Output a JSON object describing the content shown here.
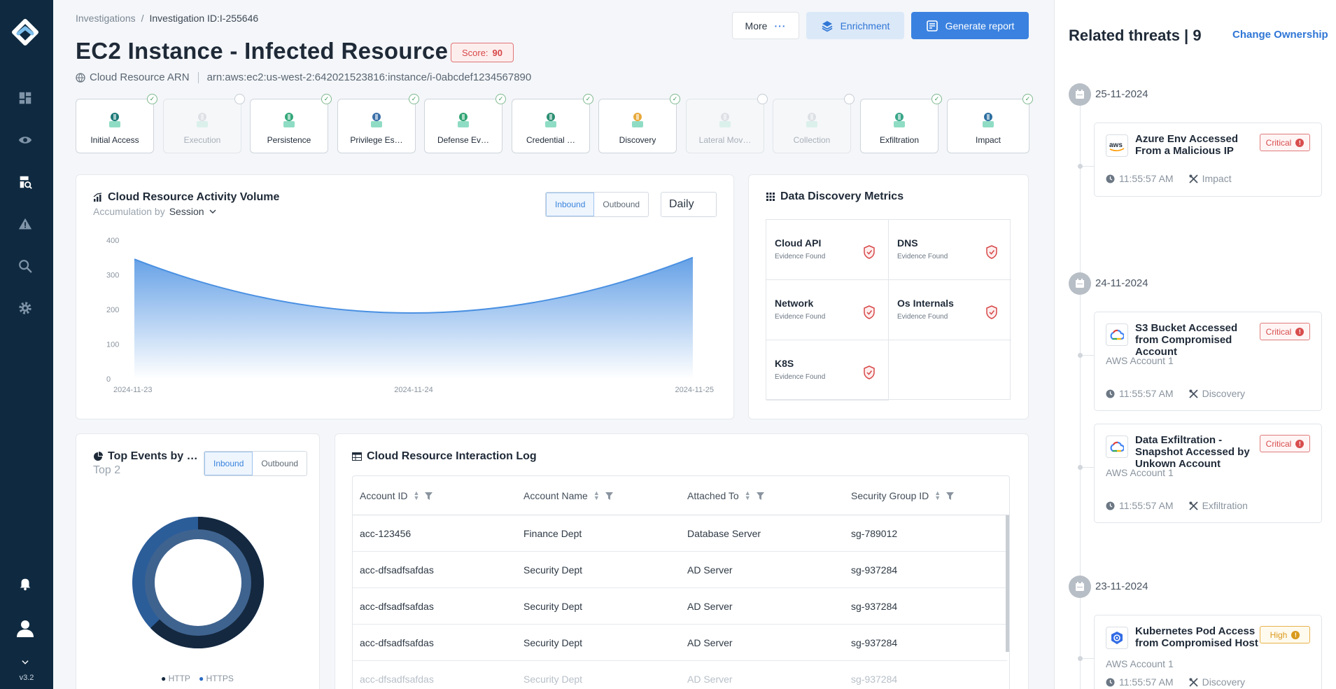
{
  "app": {
    "version": "v3.2"
  },
  "sidebar": {
    "items": [
      {
        "icon": "dashboard-icon"
      },
      {
        "icon": "eye-icon"
      },
      {
        "icon": "investigation-icon",
        "active": true
      },
      {
        "icon": "alert-icon"
      },
      {
        "icon": "search-icon"
      },
      {
        "icon": "gear-icon"
      }
    ],
    "bottom": [
      {
        "icon": "bell-icon"
      },
      {
        "icon": "user-icon"
      },
      {
        "icon": "chevron-down-icon"
      }
    ]
  },
  "breadcrumb": {
    "root": "Investigations",
    "sep": "/",
    "current": "Investigation ID:I-255646"
  },
  "header": {
    "title": "EC2 Instance - Infected Resource",
    "score_label": "Score:",
    "score_value": "90",
    "resource_type": "Cloud Resource ARN",
    "arn": "arn:aws:ec2:us-west-2:642021523816:instance/i-0abcdef1234567890"
  },
  "actions": {
    "more": "More",
    "enrichment": "Enrichment",
    "generate_report": "Generate report"
  },
  "tactics": [
    {
      "label": "Initial Access",
      "enabled": true
    },
    {
      "label": "Execution",
      "enabled": false
    },
    {
      "label": "Persistence",
      "enabled": true
    },
    {
      "label": "Privilege Es…",
      "enabled": true
    },
    {
      "label": "Defense Ev…",
      "enabled": true
    },
    {
      "label": "Credential …",
      "enabled": true
    },
    {
      "label": "Discovery",
      "enabled": true
    },
    {
      "label": "Lateral Mov…",
      "enabled": false
    },
    {
      "label": "Collection",
      "enabled": false
    },
    {
      "label": "Exfiltration",
      "enabled": true
    },
    {
      "label": "Impact",
      "enabled": true
    }
  ],
  "activity": {
    "title": "Cloud Resource Activity Volume",
    "accum_label": "Accumulation by",
    "accum_value": "Session",
    "toggle": [
      "Inbound",
      "Outbound"
    ],
    "period": "Daily"
  },
  "chart_data": {
    "type": "area",
    "x": [
      "2024-11-23",
      "2024-11-24",
      "2024-11-25"
    ],
    "y_ticks": [
      "400",
      "300",
      "200",
      "100",
      "0"
    ],
    "ylim": [
      0,
      400
    ],
    "series": [
      {
        "values": [
          345,
          190,
          350
        ]
      }
    ],
    "color": "#4a90e2"
  },
  "metrics": {
    "title": "Data Discovery Metrics",
    "items": [
      {
        "name": "Cloud API",
        "status": "Evidence Found"
      },
      {
        "name": "DNS",
        "status": "Evidence Found"
      },
      {
        "name": "Network",
        "status": "Evidence Found"
      },
      {
        "name": "Os Internals",
        "status": "Evidence Found"
      },
      {
        "name": "K8S",
        "status": "Evidence Found"
      }
    ]
  },
  "top_events": {
    "title": "Top Events by …",
    "subtitle": "Top 2",
    "toggle": [
      "Inbound",
      "Outbound"
    ],
    "legend": [
      "HTTP",
      "HTTPS"
    ],
    "colors": [
      "#12263f",
      "#2a5a94"
    ]
  },
  "log": {
    "title": "Cloud Resource Interaction Log",
    "columns": [
      "Account ID",
      "Account Name",
      "Attached To",
      "Security Group ID"
    ],
    "rows": [
      [
        "acc-123456",
        "Finance Dept",
        "Database Server",
        "sg-789012"
      ],
      [
        "acc-dfsadfsafdas",
        "Security Dept",
        "AD Server",
        "sg-937284"
      ],
      [
        "acc-dfsadfsafdas",
        "Security Dept",
        "AD Server",
        "sg-937284"
      ],
      [
        "acc-dfsadfsafdas",
        "Security Dept",
        "AD Server",
        "sg-937284"
      ],
      [
        "acc-dfsadfsafdas",
        "Security Dept",
        "AD Server",
        "sg-937284"
      ]
    ]
  },
  "threats": {
    "title": "Related threats | 9",
    "change_ownership": "Change Ownership",
    "groups": [
      {
        "date": "25-11-2024",
        "items": [
          {
            "name": "Azure Env Accessed From a Malicious IP",
            "severity": "Critical",
            "logo": "aws-logo-icon",
            "account": "",
            "time": "11:55:57 AM",
            "tactic": "Impact"
          }
        ]
      },
      {
        "date": "24-11-2024",
        "items": [
          {
            "name": "S3 Bucket Accessed from Compromised Account",
            "severity": "Critical",
            "logo": "gcp-logo-icon",
            "account": "AWS Account 1",
            "time": "11:55:57 AM",
            "tactic": "Discovery"
          },
          {
            "name": "Data Exfiltration - Snapshot Accessed by Unkown Account",
            "severity": "Critical",
            "logo": "gcp-logo-icon",
            "account": "AWS Account 1",
            "time": "11:55:57 AM",
            "tactic": "Exfiltration"
          }
        ]
      },
      {
        "date": "23-11-2024",
        "items": [
          {
            "name": "Kubernetes Pod Access from Compromised Host",
            "severity": "High",
            "logo": "kubernetes-logo-icon",
            "account": "AWS Account 1",
            "time": "11:55:57 AM",
            "tactic": "Discovery"
          }
        ]
      }
    ]
  }
}
